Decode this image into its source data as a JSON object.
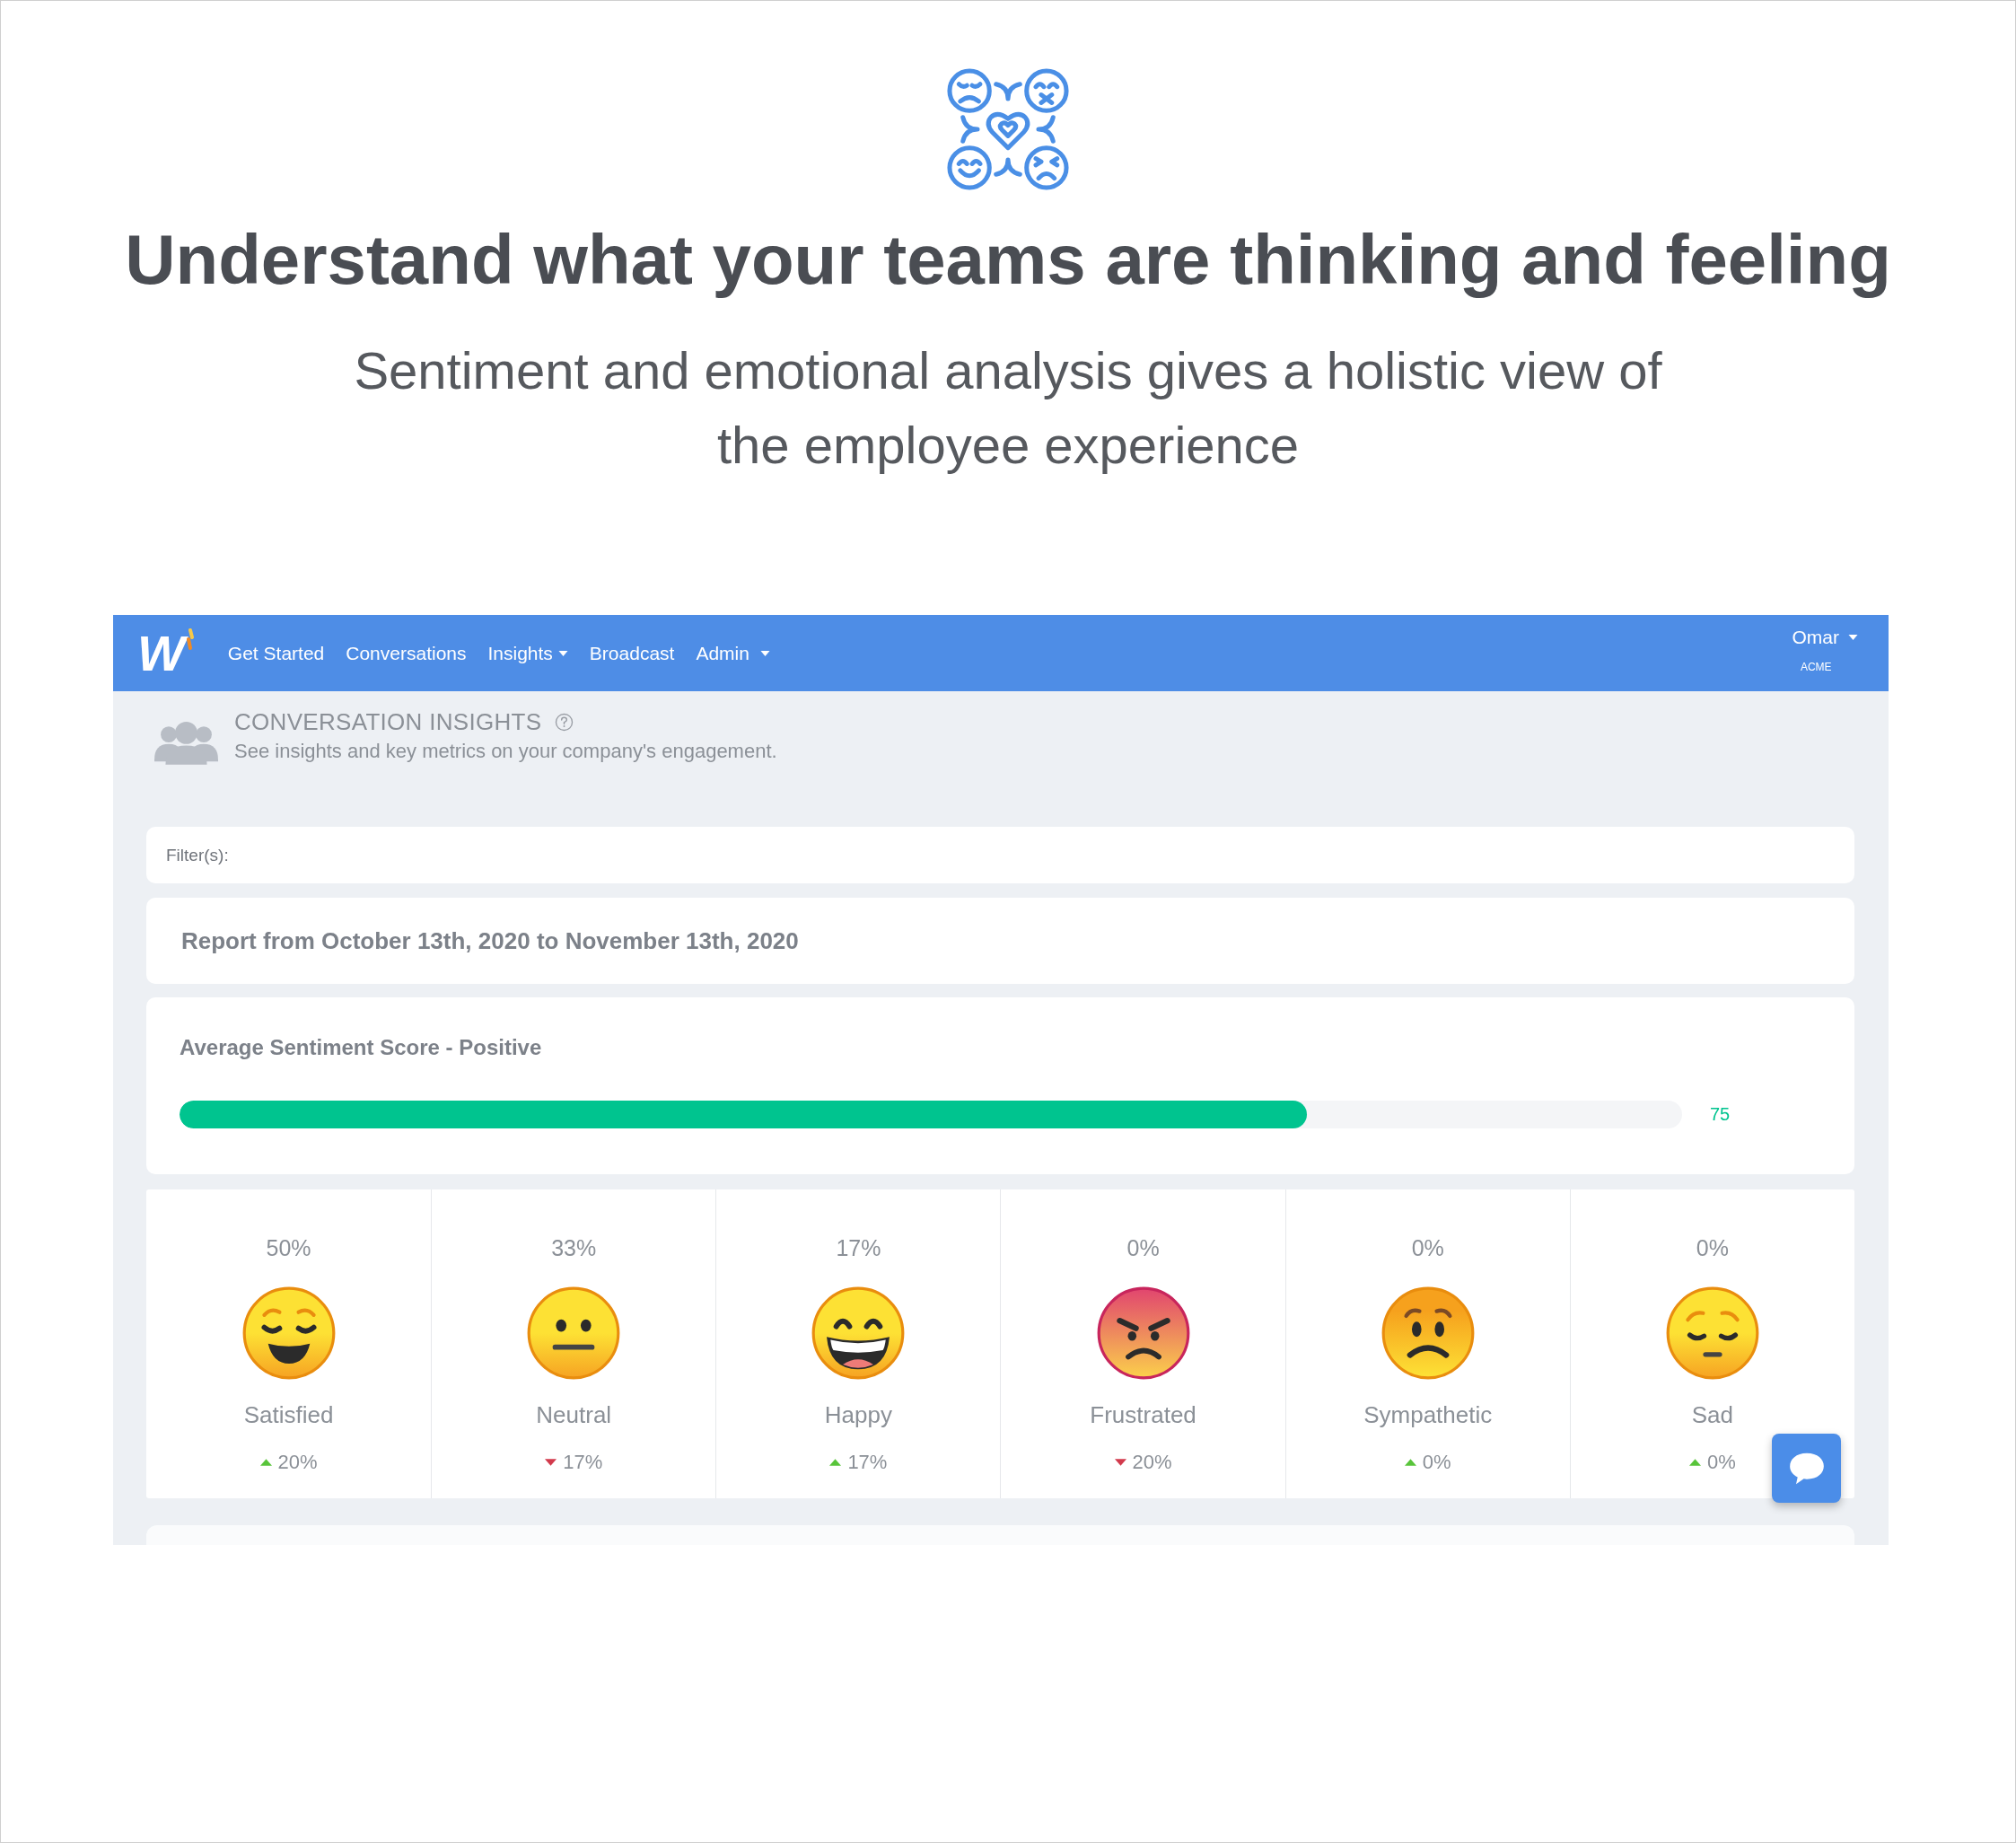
{
  "hero": {
    "title": "Understand what your teams are thinking and feeling",
    "subtitle": "Sentiment and emotional analysis gives a holistic view of the employee experience"
  },
  "app": {
    "navbar": {
      "logo": "W",
      "items": [
        {
          "label": "Get Started",
          "dropdown": false
        },
        {
          "label": "Conversations",
          "dropdown": false
        },
        {
          "label": "Insights",
          "dropdown": true
        },
        {
          "label": "Broadcast",
          "dropdown": false
        },
        {
          "label": "Admin",
          "dropdown": true
        }
      ],
      "user": {
        "name": "Omar",
        "organization": "ACME"
      }
    },
    "page_header": {
      "title": "CONVERSATION INSIGHTS",
      "description": "See insights and key metrics on your company's engagement."
    },
    "filters": {
      "label": "Filter(s):"
    },
    "report": {
      "title": "Report from October 13th, 2020 to November 13th, 2020"
    },
    "sentiment": {
      "title": "Average Sentiment Score - Positive",
      "level": 0.75,
      "reading": "75"
    },
    "emotions": [
      {
        "kind": "relieved",
        "share": "50%",
        "label": "Satisfied",
        "rising": true,
        "change": "20%"
      },
      {
        "kind": "neutral",
        "share": "33%",
        "label": "Neutral",
        "rising": false,
        "change": "17%"
      },
      {
        "kind": "grinning",
        "share": "17%",
        "label": "Happy",
        "rising": true,
        "change": "17%"
      },
      {
        "kind": "angry",
        "share": "0%",
        "label": "Frustrated",
        "rising": false,
        "change": "20%"
      },
      {
        "kind": "worried",
        "share": "0%",
        "label": "Sympathetic",
        "rising": true,
        "change": "0%"
      },
      {
        "kind": "pensive",
        "share": "0%",
        "label": "Sad",
        "rising": true,
        "change": "0%"
      }
    ]
  }
}
